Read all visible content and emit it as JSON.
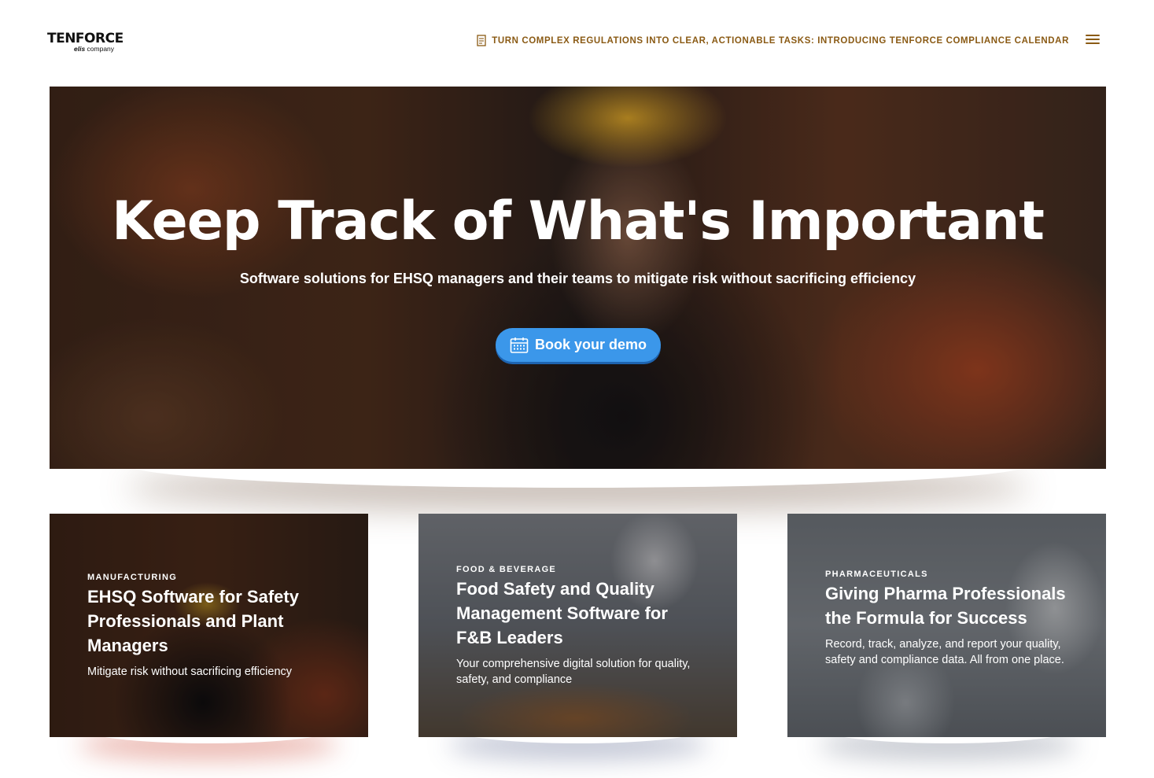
{
  "header": {
    "logo_main": "TENFORCE",
    "logo_brand": "elis",
    "logo_suffix": " company",
    "announcement": "TURN COMPLEX REGULATIONS INTO CLEAR, ACTIONABLE TASKS: INTRODUCING TENFORCE COMPLIANCE CALENDAR",
    "announcement_icon": "document-icon",
    "menu_icon": "hamburger-menu-icon",
    "accent_color": "#8a5a14"
  },
  "hero": {
    "title": "Keep Track of What's Important",
    "subtitle": "Software solutions for EHSQ managers and their teams to mitigate risk without sacrificing efficiency",
    "cta_label": "Book your demo",
    "cta_icon": "calendar-icon",
    "cta_color": "#3b97ea"
  },
  "cards": [
    {
      "eyebrow": "MANUFACTURING",
      "title": "EHSQ Software for Safety Professionals and Plant Managers",
      "description": "Mitigate risk without sacrificing efficiency"
    },
    {
      "eyebrow": "FOOD & BEVERAGE",
      "title": "Food Safety and Quality Management Software for F&B Leaders",
      "description": "Your comprehensive digital solution for quality, safety, and compliance"
    },
    {
      "eyebrow": "PHARMACEUTICALS",
      "title": "Giving Pharma Professionals the Formula for Success",
      "description": "Record, track, analyze, and report your quality, safety and compliance data. All from one place."
    }
  ]
}
